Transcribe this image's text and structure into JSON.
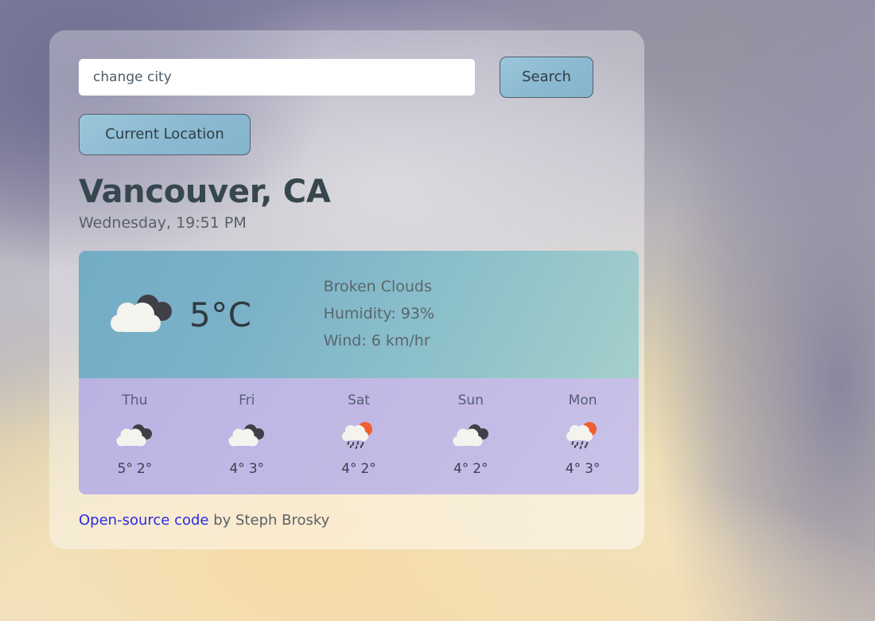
{
  "search": {
    "placeholder": "change city",
    "value": "",
    "search_label": "Search",
    "current_location_label": "Current Location"
  },
  "location": {
    "city": "Vancouver, CA",
    "datetime": "Wednesday, 19:51 PM"
  },
  "current": {
    "icon": "broken-clouds-icon",
    "temperature": "5°C",
    "description": "Broken Clouds",
    "humidity": "Humidity: 93%",
    "wind": "Wind: 6 km/hr"
  },
  "forecast": [
    {
      "day": "Thu",
      "icon": "broken-clouds-icon",
      "high": "5°",
      "low": "2°"
    },
    {
      "day": "Fri",
      "icon": "broken-clouds-icon",
      "high": "4°",
      "low": "3°"
    },
    {
      "day": "Sat",
      "icon": "sun-cloud-rain-icon",
      "high": "4°",
      "low": "2°"
    },
    {
      "day": "Sun",
      "icon": "broken-clouds-icon",
      "high": "4°",
      "low": "2°"
    },
    {
      "day": "Mon",
      "icon": "sun-cloud-rain-icon",
      "high": "4°",
      "low": "3°"
    }
  ],
  "footer": {
    "link_text": "Open-source code",
    "credit_text": " by Steph Brosky"
  },
  "colors": {
    "button": "#8ab9d1",
    "card_top": "#7cb2c8",
    "card_bottom": "#c0b8e4",
    "title": "#37474f",
    "link": "#2c2cdd",
    "sun": "#ef5f32",
    "cloud_dark": "#3f3f47",
    "cloud_light": "#f5f3ee"
  }
}
